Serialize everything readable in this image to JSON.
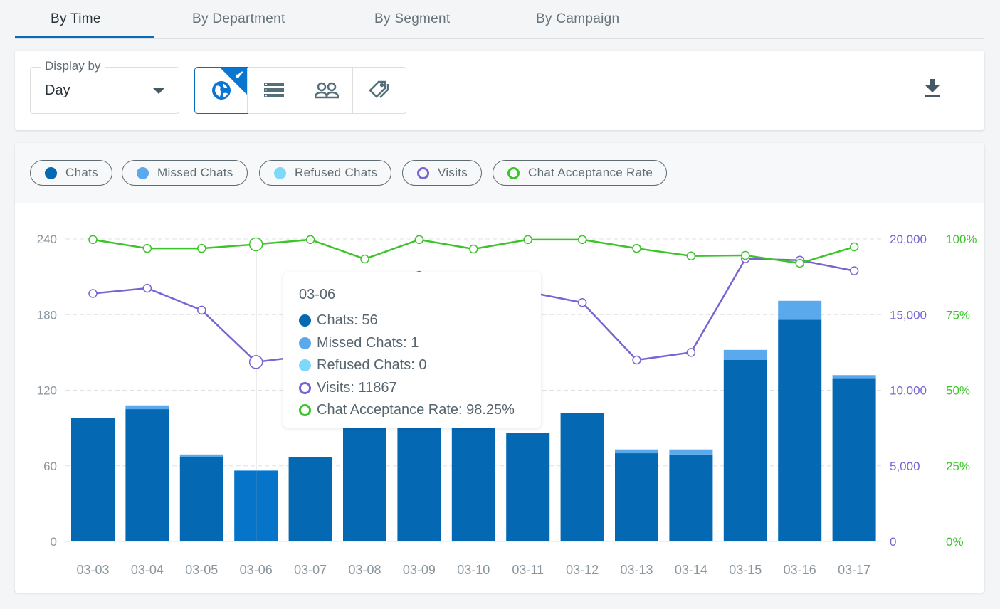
{
  "tabs": [
    {
      "label": "By Time",
      "active": true
    },
    {
      "label": "By Department"
    },
    {
      "label": "By Segment"
    },
    {
      "label": "By Campaign"
    }
  ],
  "toolbar": {
    "display_by_label": "Display by",
    "display_by_value": "Day",
    "views": [
      "globe-icon",
      "list-icon",
      "users-icon",
      "tags-icon"
    ],
    "active_view": "globe-icon",
    "download_icon": "download-icon"
  },
  "colors": {
    "chats": "#0568b3",
    "missed": "#5aa9ec",
    "refused": "#7dd8fb",
    "visits": "#7a63d3",
    "rate": "#3cc42a"
  },
  "legend": [
    "Chats",
    "Missed Chats",
    "Refused Chats",
    "Visits",
    "Chat Acceptance Rate"
  ],
  "tooltip": {
    "date": "03-06",
    "chats": "Chats: 56",
    "missed": "Missed Chats: 1",
    "refused": "Refused Chats: 0",
    "visits": "Visits: 11867",
    "rate": "Chat Acceptance Rate: 98.25%"
  },
  "chart_data": {
    "type": "bar+line",
    "categories": [
      "03-03",
      "03-04",
      "03-05",
      "03-06",
      "03-07",
      "03-08",
      "03-09",
      "03-10",
      "03-11",
      "03-12",
      "03-13",
      "03-14",
      "03-15",
      "03-16",
      "03-17"
    ],
    "y_left": {
      "ticks": [
        "0",
        "60",
        "120",
        "180",
        "240"
      ],
      "range": [
        0,
        240
      ]
    },
    "y_right_visits": {
      "ticks": [
        "0",
        "5,000",
        "10,000",
        "15,000",
        "20,000"
      ],
      "range": [
        0,
        20000
      ]
    },
    "y_right_rate": {
      "ticks": [
        "0%",
        "25%",
        "50%",
        "75%",
        "100%"
      ],
      "range": [
        0,
        100
      ]
    },
    "grid": true,
    "series": [
      {
        "name": "Chats",
        "type": "bar",
        "stack": "s",
        "values": [
          98,
          105,
          67,
          56,
          67,
          95,
          95,
          95,
          86,
          102,
          70,
          69,
          144,
          176,
          129
        ]
      },
      {
        "name": "Missed Chats",
        "type": "bar",
        "stack": "s",
        "values": [
          0,
          3,
          2,
          1,
          0,
          0,
          0,
          0,
          0,
          0,
          3,
          4,
          8,
          15,
          3
        ]
      },
      {
        "name": "Refused Chats",
        "type": "bar",
        "stack": "s",
        "values": [
          0,
          0,
          0,
          0,
          0,
          0,
          0,
          0,
          0,
          0,
          0,
          0,
          0,
          0,
          0
        ]
      },
      {
        "name": "Visits",
        "type": "line",
        "axis": "visits",
        "values": [
          16400,
          16750,
          15300,
          11867,
          12300,
          17000,
          17600,
          17000,
          16500,
          15800,
          12000,
          12500,
          18700,
          18600,
          17900
        ]
      },
      {
        "name": "Chat Acceptance Rate",
        "type": "line",
        "axis": "rate",
        "values": [
          99.8,
          96.9,
          96.9,
          98.25,
          99.8,
          93.4,
          99.8,
          96.7,
          99.8,
          99.8,
          96.9,
          94.4,
          94.6,
          92,
          97.4
        ]
      }
    ],
    "highlighted": "03-06"
  }
}
